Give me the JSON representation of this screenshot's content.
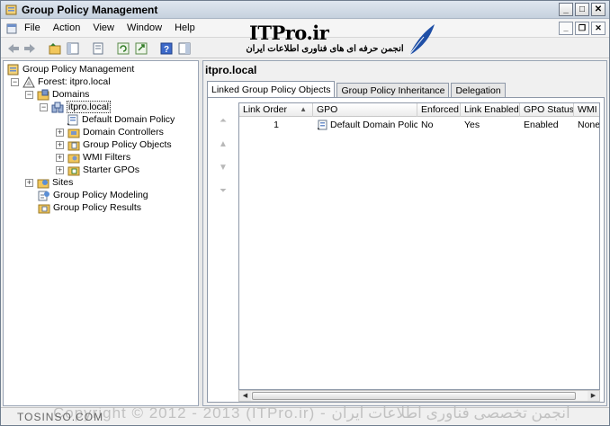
{
  "window": {
    "title": "Group Policy Management"
  },
  "menu": [
    "File",
    "Action",
    "View",
    "Window",
    "Help"
  ],
  "logo": {
    "brand": "ITPro.ir",
    "tagline": "انجمن حرفه ای های فناوری اطلاعات ایران"
  },
  "tree": {
    "root": "Group Policy Management",
    "forest": "Forest: itpro.local",
    "domains": "Domains",
    "domain": "itpro.local",
    "children": [
      "Default Domain Policy",
      "Domain Controllers",
      "Group Policy Objects",
      "WMI Filters",
      "Starter GPOs"
    ],
    "sites": "Sites",
    "modeling": "Group Policy Modeling",
    "results": "Group Policy Results"
  },
  "details": {
    "title": "itpro.local",
    "tabs": [
      "Linked Group Policy Objects",
      "Group Policy Inheritance",
      "Delegation"
    ],
    "columns": [
      "Link Order",
      "GPO",
      "Enforced",
      "Link Enabled",
      "GPO Status",
      "WMI"
    ],
    "rows": [
      {
        "link_order": "1",
        "gpo": "Default Domain Policy",
        "enforced": "No",
        "link_enabled": "Yes",
        "gpo_status": "Enabled",
        "wmi": "None"
      }
    ]
  },
  "watermark": {
    "site": "TOSINSO.COM",
    "copyright": "Copyright © 2012 - 2013 (ITPro.ir) - انجمن تخصصی فناوری اطلاعات ایران"
  }
}
